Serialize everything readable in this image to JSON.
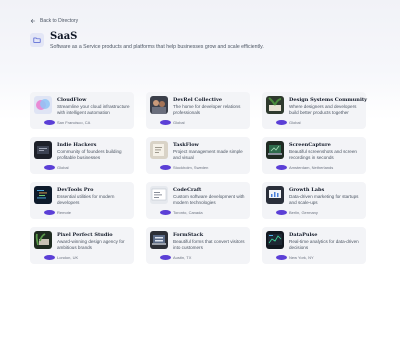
{
  "nav": {
    "back_label": "Back to Directory"
  },
  "category": {
    "title": "SaaS",
    "description": "Software as a Service products and platforms that help businesses grow and scale efficiently."
  },
  "colors": {
    "accent": "#6d4fd8",
    "card_bg": "#f3f4f7",
    "icon_bg": "#e3e6f6"
  },
  "companies": [
    {
      "name": "CloudFlow",
      "description": "Streamline your cloud infrastructure with intelligent automation",
      "location": "San Francisco, CA",
      "logo": "cloud-abstract"
    },
    {
      "name": "DevRel Collective",
      "description": "The home for developer relations professionals",
      "location": "Global",
      "logo": "people-photo"
    },
    {
      "name": "Design Systems Community",
      "description": "Where designers and developers build better products together",
      "location": "Global",
      "logo": "plant-desk"
    },
    {
      "name": "Indie Hackers",
      "description": "Community of founders building profitable businesses",
      "location": "Global",
      "logo": "laptop-dark"
    },
    {
      "name": "TaskFlow",
      "description": "Project management made simple and visual",
      "location": "Stockholm, Sweden",
      "logo": "notebook"
    },
    {
      "name": "ScreenCapture",
      "description": "Beautiful screenshots and screen recordings in seconds",
      "location": "Amsterdam, Netherlands",
      "logo": "laptop-green"
    },
    {
      "name": "DevTools Pro",
      "description": "Essential utilities for modern developers",
      "location": "Remote",
      "logo": "code-screen"
    },
    {
      "name": "CodeCraft",
      "description": "Custom software development with modern technologies",
      "location": "Toronto, Canada",
      "logo": "code-window"
    },
    {
      "name": "Growth Labs",
      "description": "Data-driven marketing for startups and scale-ups",
      "location": "Berlin, Germany",
      "logo": "laptop-charts"
    },
    {
      "name": "Pixel Perfect Studio",
      "description": "Award-winning design agency for ambitious brands",
      "location": "London, UK",
      "logo": "desk-plants"
    },
    {
      "name": "FormStack",
      "description": "Beautiful forms that convert visitors into customers",
      "location": "Austin, TX",
      "logo": "laptop-form"
    },
    {
      "name": "DataPulse",
      "description": "Real-time analytics for data-driven decisions",
      "location": "New York, NY",
      "logo": "dashboard-dark"
    }
  ]
}
